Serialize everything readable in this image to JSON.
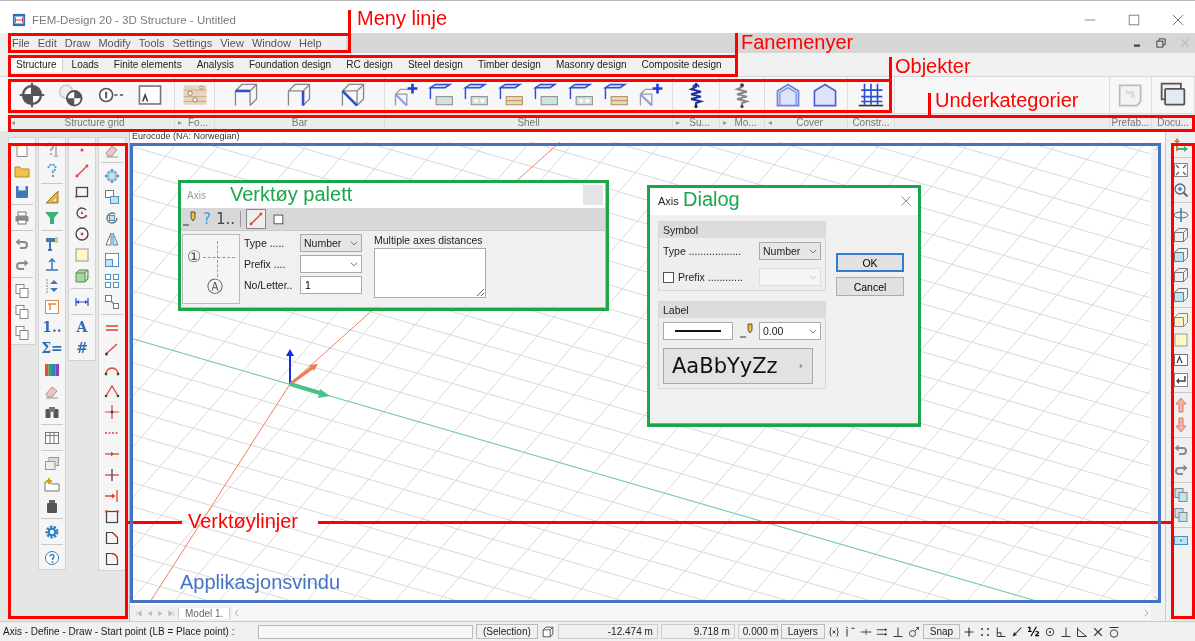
{
  "window": {
    "title": "FEM-Design 20 - 3D Structure - Untitled"
  },
  "menu": [
    "File",
    "Edit",
    "Draw",
    "Modify",
    "Tools",
    "Settings",
    "View",
    "Window",
    "Help"
  ],
  "tabs": [
    {
      "label": "Structure",
      "selected": true
    },
    {
      "label": "Loads",
      "selected": false
    },
    {
      "label": "Finite elements",
      "selected": false
    },
    {
      "label": "Analysis",
      "selected": false
    },
    {
      "label": "Foundation design",
      "selected": false
    },
    {
      "label": "RC design",
      "selected": false
    },
    {
      "label": "Steel design",
      "selected": false
    },
    {
      "label": "Timber design",
      "selected": false
    },
    {
      "label": "Masonry design",
      "selected": false
    },
    {
      "label": "Composite design",
      "selected": false
    }
  ],
  "ribbon": {
    "groups": [
      {
        "label": "Structure grid",
        "arrow": "◂"
      },
      {
        "label": "Fo...",
        "arrow": "▸"
      },
      {
        "label": "Bar"
      },
      {
        "label": "Shell"
      },
      {
        "label": "Su...",
        "arrow": "▸"
      },
      {
        "label": "Mo...",
        "arrow": "▸"
      },
      {
        "label": "Cover",
        "arrow": "◂"
      },
      {
        "label": "Constr..."
      }
    ],
    "side_groups": [
      {
        "label": "Prefab..."
      },
      {
        "label": "Docu..."
      }
    ]
  },
  "left_toolbars": {
    "column_2_glyphs": [
      "1..",
      "Σ="
    ],
    "column_3_glyphs": [
      "A",
      "#"
    ]
  },
  "canvas": {
    "standard": "Eurocode (NA: Norwegian)",
    "model_tab": "Model 1."
  },
  "palette": {
    "title": "Axis",
    "toolbar_glyphs": [
      "?",
      "1.."
    ],
    "symbol_glyphs": [
      "①",
      "Ⓐ"
    ],
    "type": {
      "label": "Type .....",
      "value": "Number"
    },
    "prefix": {
      "label": "Prefix ...."
    },
    "number": {
      "label": "No/Letter..",
      "value": "1"
    },
    "distances": {
      "label": "Multiple axes distances"
    }
  },
  "dialog": {
    "title": "Axis",
    "symbol_group": {
      "title": "Symbol",
      "type": {
        "label": "Type ..................",
        "value": "Number"
      },
      "prefix": {
        "label": "Prefix ............",
        "checked": false,
        "disabled": true
      }
    },
    "label_group": {
      "title": "Label",
      "pen_value": "0.00",
      "font_sample": "AaBbYyZz"
    },
    "buttons": [
      {
        "label": "OK",
        "default": true
      },
      {
        "label": "Cancel",
        "default": false
      }
    ]
  },
  "status_bar": {
    "prompt": "Axis - Define - Draw - Start point (LB = Place point) :",
    "selection": "(Selection)",
    "coordinates": [
      "-12.474 m",
      "9.718 m",
      "0.000 m"
    ],
    "layers": "Layers",
    "snap": "Snap",
    "snap_glyph": "½"
  },
  "annotations": [
    {
      "label": "Meny linje",
      "color": "#ff0000"
    },
    {
      "label": "Fanemenyer",
      "color": "#ff0000"
    },
    {
      "label": "Objekter",
      "color": "#ff0000"
    },
    {
      "label": "Underkategorier",
      "color": "#ff0000"
    },
    {
      "label": "Verktøy palett",
      "color": "#19a74a"
    },
    {
      "label": "Dialog",
      "color": "#19a74a"
    },
    {
      "label": "Verktøylinjer",
      "color": "#ff0000"
    },
    {
      "label": "Applikasjonsvindu",
      "color": "#4472c4"
    }
  ]
}
